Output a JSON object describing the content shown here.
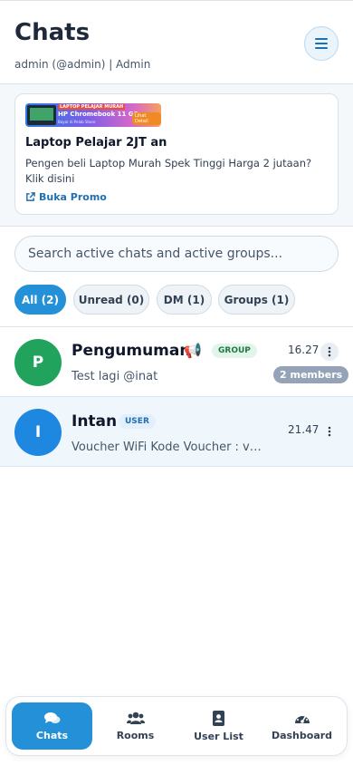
{
  "header": {
    "title": "Chats",
    "subtitle": "admin (@admin) | Admin"
  },
  "promo": {
    "banner_tag": "LAPTOP PELAJAR MURAH",
    "banner_product": "HP Chromebook 11 G6",
    "banner_button": "Lihat Detail",
    "banner_footer": "Bayar di Pelab Shore",
    "title": "Laptop Pelajar 2JT an",
    "description": "Pengen beli Laptop Murah Spek Tinggi Harga 2 jutaan? Klik disini",
    "link_label": "Buka Promo"
  },
  "search": {
    "placeholder": "Search active chats and active groups..."
  },
  "filters": [
    {
      "label": "All (2)",
      "active": true
    },
    {
      "label": "Unread (0)",
      "active": false
    },
    {
      "label": "DM (1)",
      "active": false
    },
    {
      "label": "Groups (1)",
      "active": false
    }
  ],
  "chats": [
    {
      "initial": "P",
      "name": "Pengumuman",
      "emoji": "📢",
      "badge": "GROUP",
      "preview": "Test lagi @inat",
      "time": "16.27",
      "members": "2 members",
      "avatar_color": "#22a35d"
    },
    {
      "initial": "I",
      "name": "Intan",
      "badge": "USER",
      "preview": "Voucher WiFi Kode Voucher : vv...",
      "time": "21.47",
      "avatar_color": "#1e88e0"
    }
  ],
  "nav": [
    {
      "label": "Chats",
      "icon": "comments-icon",
      "active": true
    },
    {
      "label": "Rooms",
      "icon": "users-icon",
      "active": false
    },
    {
      "label": "User List",
      "icon": "address-book-icon",
      "active": false
    },
    {
      "label": "Dashboard",
      "icon": "gauge-icon",
      "active": false
    }
  ],
  "colors": {
    "accent": "#2490d8",
    "group_badge": "#1e7a45",
    "user_badge": "#1f6fb2"
  }
}
